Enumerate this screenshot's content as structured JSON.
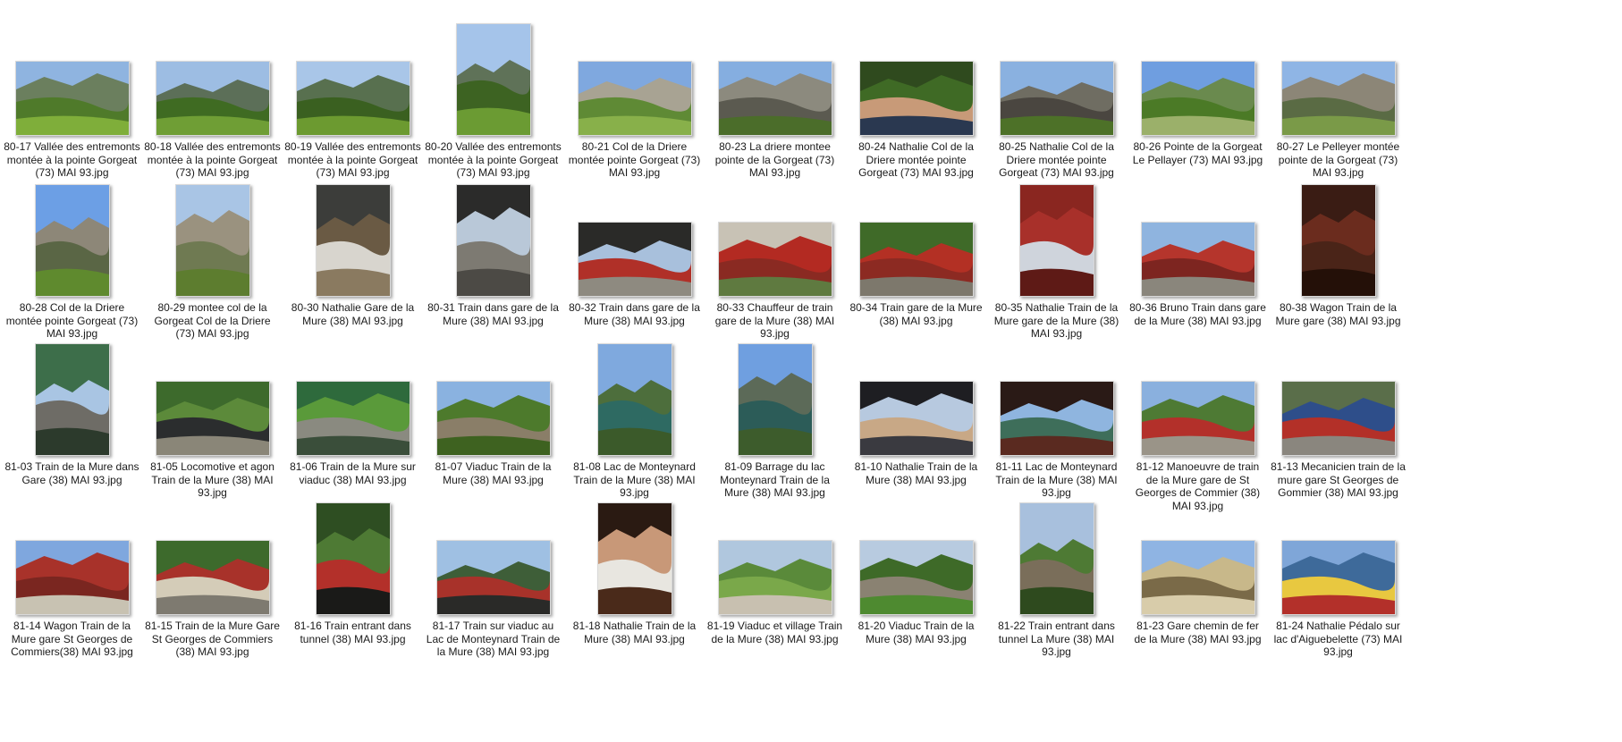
{
  "view": "large-icons",
  "files": [
    {
      "name": "80-17 Vallée des entremonts montée à la pointe Gorgeat (73) MAI 93.jpg",
      "orientation": "landscape",
      "scene": "mountain valley meadow",
      "colors": [
        "#8fb4e0",
        "#6b7f5e",
        "#4f7a2a",
        "#7fae3a"
      ]
    },
    {
      "name": "80-18 Vallée des entremonts montée à la pointe Gorgeat (73) MAI 93.jpg",
      "orientation": "landscape",
      "scene": "mountain valley",
      "colors": [
        "#9dbde3",
        "#5c6f58",
        "#3f6b22",
        "#6f9e35"
      ]
    },
    {
      "name": "80-19 Vallée des entremonts montée à la pointe Gorgeat (73) MAI 93.jpg",
      "orientation": "landscape",
      "scene": "mountain forest",
      "colors": [
        "#a9c6e8",
        "#58704f",
        "#3a6020",
        "#6c9a30"
      ]
    },
    {
      "name": "80-20 Vallée des entremonts montée à la pointe Gorgeat (73) MAI 93.jpg",
      "orientation": "portrait",
      "scene": "mountain valley",
      "colors": [
        "#a5c4ea",
        "#5f7258",
        "#3d6322",
        "#6b9b33"
      ]
    },
    {
      "name": "80-21 Col de la Driere montée pointe Gorgeat (73) MAI 93.jpg",
      "orientation": "landscape",
      "scene": "rocky peak",
      "colors": [
        "#7fa8df",
        "#a8a393",
        "#5f8a35",
        "#88b04a"
      ]
    },
    {
      "name": "80-23 La driere montee pointe de la Gorgeat (73) MAI 93.jpg",
      "orientation": "landscape",
      "scene": "rock cliff",
      "colors": [
        "#85aee0",
        "#8c8a7e",
        "#5b5a50",
        "#4b6d2a"
      ]
    },
    {
      "name": "80-24 Nathalie  Col de la Driere montée pointe Gorgeat (73) MAI 93.jpg",
      "orientation": "landscape",
      "scene": "portrait person",
      "colors": [
        "#2f4a1e",
        "#3f6a25",
        "#c89a78",
        "#2a3850"
      ]
    },
    {
      "name": "80-25 Nathalie Col de la Driere montée pointe Gorgeat (73) MAI 93.jpg",
      "orientation": "landscape",
      "scene": "ridge",
      "colors": [
        "#8ab1e0",
        "#6f6d62",
        "#4a4640",
        "#4d7128"
      ]
    },
    {
      "name": "80-26 Pointe de la Gorgeat Le Pellayer (73) MAI 93.jpg",
      "orientation": "landscape",
      "scene": "summit",
      "colors": [
        "#6f9ee0",
        "#6a8a4e",
        "#4b7a26",
        "#9bb06a"
      ]
    },
    {
      "name": "80-27 Le Pelleyer montée pointe de la Gorgeat (73) MAI 93.jpg",
      "orientation": "landscape",
      "scene": "cliffs",
      "colors": [
        "#8fb5e5",
        "#8c8677",
        "#5a6b44",
        "#7a9a48"
      ]
    },
    {
      "name": "80-28 Col de la Driere montée pointe Gorgeat (73) MAI 93.jpg",
      "orientation": "portrait",
      "scene": "rock spire",
      "colors": [
        "#6c9fe5",
        "#8d8778",
        "#5a6645",
        "#5f8a2e"
      ]
    },
    {
      "name": "80-29 montee col de la Gorgeat Col de la Driere (73) MAI 93.jpg",
      "orientation": "portrait",
      "scene": "rock slope",
      "colors": [
        "#a9c5e5",
        "#9a927f",
        "#6f7a52",
        "#5d7d2f"
      ]
    },
    {
      "name": "80-30 Nathalie Gare de la Mure (38) MAI 93.jpg",
      "orientation": "portrait",
      "scene": "person sitting",
      "colors": [
        "#3c3d3a",
        "#6a5a44",
        "#d8d5ce",
        "#8a7a60"
      ]
    },
    {
      "name": "80-31 Train dans gare de la Mure (38) MAI 93.jpg",
      "orientation": "portrait",
      "scene": "station platform clock",
      "colors": [
        "#2b2b2a",
        "#b9c8d8",
        "#7d7a72",
        "#4c4a45"
      ]
    },
    {
      "name": "80-32 Train dans gare de la Mure (38) MAI 93.jpg",
      "orientation": "landscape",
      "scene": "station red train",
      "colors": [
        "#2a2a28",
        "#a8c0dc",
        "#b03028",
        "#8e8a80"
      ]
    },
    {
      "name": "80-33 Chauffeur de train gare de la Mure (38) MAI 93.jpg",
      "orientation": "landscape",
      "scene": "red locomotive",
      "colors": [
        "#c8c2b5",
        "#b32a22",
        "#8a2a22",
        "#5f7a40"
      ]
    },
    {
      "name": "80-34 Train gare de la Mure (38) MAI 93.jpg",
      "orientation": "landscape",
      "scene": "red train",
      "colors": [
        "#3f6a28",
        "#b33024",
        "#8c2a22",
        "#7d786c"
      ]
    },
    {
      "name": "80-35 Nathalie Train de la Mure gare de la Mure (38) MAI 93.jpg",
      "orientation": "portrait",
      "scene": "red wagon window",
      "colors": [
        "#8a2620",
        "#a8302a",
        "#cfd4dc",
        "#5e1a16"
      ]
    },
    {
      "name": "80-36 Bruno Train dans gare de la Mure (38) MAI 93.jpg",
      "orientation": "landscape",
      "scene": "red wagon",
      "colors": [
        "#8fb4df",
        "#b5352c",
        "#7d2520",
        "#8a867c"
      ]
    },
    {
      "name": "80-38 Wagon Train de la Mure gare (38) MAI 93.jpg",
      "orientation": "portrait",
      "scene": "wagon interior",
      "colors": [
        "#3a1c14",
        "#6b2c1e",
        "#4a2418",
        "#241008"
      ]
    },
    {
      "name": "81-03 Train de la Mure dans Gare (38) MAI 93.jpg",
      "orientation": "portrait",
      "scene": "platform",
      "colors": [
        "#3d6e4a",
        "#a9c5e3",
        "#6e6c66",
        "#2c3a2c"
      ]
    },
    {
      "name": "81-05 Locomotive et agon Train de la Mure (38) MAI 93.jpg",
      "orientation": "landscape",
      "scene": "locomotive",
      "colors": [
        "#3d6a2c",
        "#5c8a3a",
        "#2b2d2e",
        "#8a8678"
      ]
    },
    {
      "name": "81-06 Train de la Mure sur viaduc (38) MAI 93.jpg",
      "orientation": "landscape",
      "scene": "train on viaduct",
      "colors": [
        "#2e6a3c",
        "#5a9a3a",
        "#8a8a80",
        "#3a4e3a"
      ]
    },
    {
      "name": "81-07 Viaduc Train de la Mure (38) MAI 93.jpg",
      "orientation": "landscape",
      "scene": "stone viaduct",
      "colors": [
        "#8ab2e0",
        "#4d7a2c",
        "#8a7e68",
        "#3e6220"
      ]
    },
    {
      "name": "81-08 Lac de Monteynard Train de la Mure (38) MAI 93.jpg",
      "orientation": "portrait",
      "scene": "lake gorge",
      "colors": [
        "#7fa9de",
        "#4d6e3c",
        "#2e6a62",
        "#3b5a2a"
      ]
    },
    {
      "name": "81-09 Barrage du lac Monteynard Train de la Mure (38) MAI 93.jpg",
      "orientation": "portrait",
      "scene": "dam lake",
      "colors": [
        "#6f9fe0",
        "#5c6a58",
        "#2c5c58",
        "#3d5c2c"
      ]
    },
    {
      "name": "81-10 Nathalie Train de la Mure (38) MAI 93.jpg",
      "orientation": "landscape",
      "scene": "person at window",
      "colors": [
        "#1e1e22",
        "#b7c9df",
        "#c8a886",
        "#3a3a40"
      ]
    },
    {
      "name": "81-11 Lac de Monteynard Train de la Mure (38) MAI 93.jpg",
      "orientation": "landscape",
      "scene": "lake through window",
      "colors": [
        "#2a1a16",
        "#8fb5df",
        "#3e6e5a",
        "#5a2a20"
      ]
    },
    {
      "name": "81-12 Manoeuvre de train de la Mure gare de St Georges de Commier (38) MAI 93.jpg",
      "orientation": "landscape",
      "scene": "red locomotive hills",
      "colors": [
        "#8ab0de",
        "#4e7a34",
        "#b3302a",
        "#9a9488"
      ]
    },
    {
      "name": "81-13 Mecanicien train de la mure gare St Georges de Gommier (38) MAI 93.jpg",
      "orientation": "landscape",
      "scene": "mechanic",
      "colors": [
        "#5a6e4a",
        "#2e4e8a",
        "#b33028",
        "#8a867e"
      ]
    },
    {
      "name": "81-14 Wagon Train de la Mure gare St Georges de Commiers(38) MAI 93.jpg",
      "orientation": "landscape",
      "scene": "red wagon",
      "colors": [
        "#7fa7de",
        "#a8322a",
        "#7a2620",
        "#c8c2b2"
      ]
    },
    {
      "name": "81-15 Train de la Mure Gare St Georges de Commiers (38) MAI 93.jpg",
      "orientation": "landscape",
      "scene": "train platform",
      "colors": [
        "#3d6a2c",
        "#a8322a",
        "#d4ccb8",
        "#7e7a70"
      ]
    },
    {
      "name": "81-16 Train entrant dans tunnel (38) MAI 93.jpg",
      "orientation": "portrait",
      "scene": "tunnel",
      "colors": [
        "#2e4e22",
        "#4e7a34",
        "#b3302a",
        "#1a1a18"
      ]
    },
    {
      "name": "81-17 Train sur viaduc au Lac de Monteynard Train de la Mure (38) MAI 93.jpg",
      "orientation": "landscape",
      "scene": "viaduct lake",
      "colors": [
        "#9fc0e3",
        "#3e5e38",
        "#a8322a",
        "#2a2a28"
      ]
    },
    {
      "name": "81-18 Nathalie Train de la Mure (38) MAI 93.jpg",
      "orientation": "portrait",
      "scene": "person white shirt",
      "colors": [
        "#2a1a12",
        "#c89878",
        "#e8e6e0",
        "#4a2a1a"
      ]
    },
    {
      "name": "81-19 Viaduc et village Train de la Mure (38) MAI 93.jpg",
      "orientation": "landscape",
      "scene": "village valley",
      "colors": [
        "#b0c7de",
        "#5a8a3a",
        "#7aa84a",
        "#c8c0b0"
      ]
    },
    {
      "name": "81-20 Viaduc Train de la Mure (38) MAI 93.jpg",
      "orientation": "landscape",
      "scene": "viaduct forest",
      "colors": [
        "#b8cbe0",
        "#3e6a28",
        "#8a8272",
        "#4e8a30"
      ]
    },
    {
      "name": "81-22 Train entrant dans tunnel La Mure (38) MAI 93.jpg",
      "orientation": "portrait",
      "scene": "tunnel cliff",
      "colors": [
        "#a8c0dd",
        "#4e7a34",
        "#7a6e5a",
        "#2e4a1e"
      ]
    },
    {
      "name": "81-23 Gare chemin de fer de la Mure (38) MAI 93.jpg",
      "orientation": "landscape",
      "scene": "station building",
      "colors": [
        "#8fb4e3",
        "#c8b88a",
        "#7a6a48",
        "#d8ccaa"
      ]
    },
    {
      "name": "81-24 Nathalie Pédalo sur lac d'Aiguebelette (73) MAI 93.jpg",
      "orientation": "landscape",
      "scene": "pedal boat lake",
      "colors": [
        "#7fa6d8",
        "#3e6a9a",
        "#e8c840",
        "#b3302a"
      ]
    }
  ]
}
